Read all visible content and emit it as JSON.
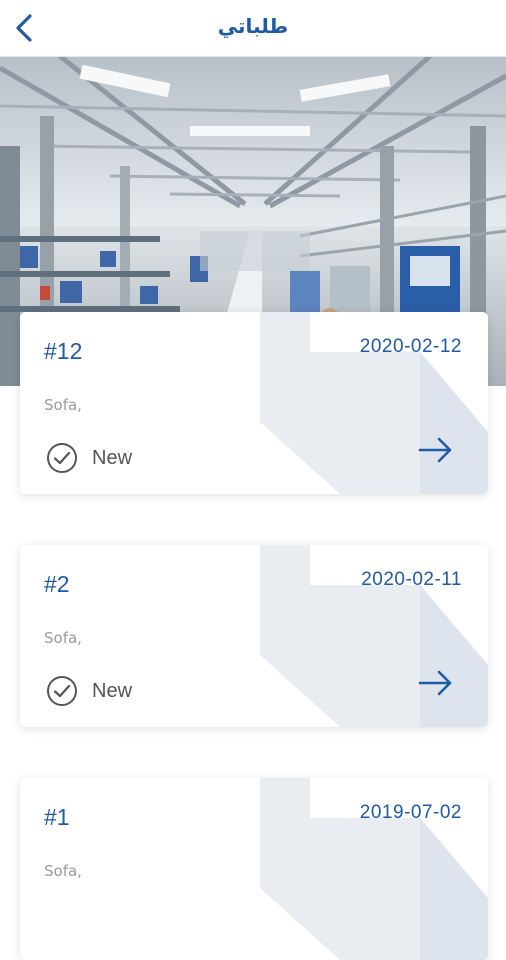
{
  "header": {
    "title": "طلباتي",
    "back_icon": "chevron-left-icon"
  },
  "colors": {
    "accent": "#1f5aa6",
    "card_watermark": "#e1e6ee",
    "text_muted": "#9a9a9a"
  },
  "orders": [
    {
      "number": "#12",
      "date": "2020-02-12",
      "product": "Sofa,",
      "status": "New"
    },
    {
      "number": "#2",
      "date": "2020-02-11",
      "product": "Sofa,",
      "status": "New"
    },
    {
      "number": "#1",
      "date": "2019-07-02",
      "product": "Sofa,",
      "status": ""
    }
  ]
}
